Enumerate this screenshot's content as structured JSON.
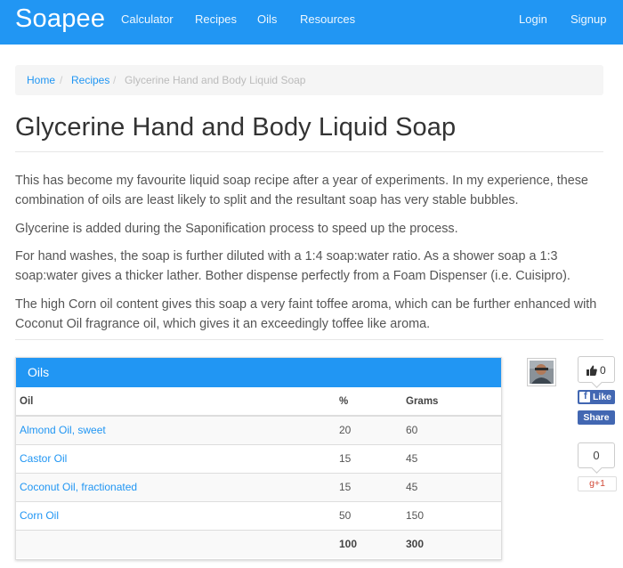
{
  "navbar": {
    "brand": "Soapee",
    "links": [
      "Calculator",
      "Recipes",
      "Oils",
      "Resources"
    ],
    "login": "Login",
    "signup": "Signup"
  },
  "breadcrumb": {
    "home": "Home",
    "recipes": "Recipes",
    "separator": "/",
    "current": "Glycerine Hand and Body Liquid Soap"
  },
  "recipe": {
    "title": "Glycerine Hand and Body Liquid Soap",
    "paragraphs": [
      "This has become my favourite liquid soap recipe after a year of experiments. In my experience, these combination of oils are least likely to split and the resultant soap has very stable bubbles.",
      "Glycerine is added during the Saponification process to speed up the process.",
      "For hand washes, the soap is further diluted with a 1:4 soap:water ratio. As a shower soap a 1:3 soap:water gives a thicker lather. Bother dispense perfectly from a Foam Dispenser (i.e. Cuisipro).",
      "The high Corn oil content gives this soap a very faint toffee aroma, which can be further enhanced with Coconut Oil fragrance oil, which gives it an exceedingly toffee like aroma."
    ]
  },
  "oils_panel": {
    "title": "Oils",
    "columns": [
      "Oil",
      "%",
      "Grams"
    ],
    "rows": [
      {
        "oil": "Almond Oil, sweet",
        "percent": "20",
        "grams": "60"
      },
      {
        "oil": "Castor Oil",
        "percent": "15",
        "grams": "45"
      },
      {
        "oil": "Coconut Oil, fractionated",
        "percent": "15",
        "grams": "45"
      },
      {
        "oil": "Corn Oil",
        "percent": "50",
        "grams": "150"
      }
    ],
    "totals": {
      "percent": "100",
      "grams": "300"
    }
  },
  "social": {
    "thumbs_count": "0",
    "fb_like": "Like",
    "fb_share": "Share",
    "gplus_count": "0",
    "gplus_label": "g+1"
  },
  "colors": {
    "accent": "#2196f3",
    "facebook": "#4267b2",
    "gplus": "#d14836"
  }
}
